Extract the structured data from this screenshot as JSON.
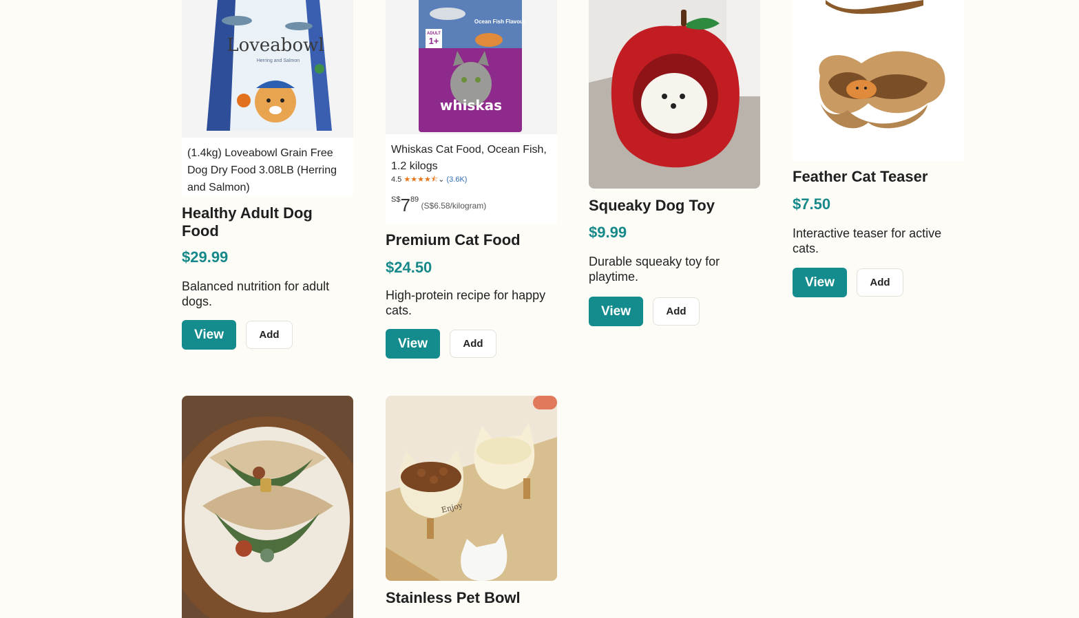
{
  "products": [
    {
      "title": "Healthy Adult Dog Food",
      "price": "$29.99",
      "description": "Balanced nutrition for adult dogs.",
      "view_label": "View",
      "add_label": "Add",
      "image": {
        "bag_brand": "Loveabowl",
        "bag_subtitle": "Herring and Salmon",
        "caption": "(1.4kg) Loveabowl Grain Free Dog Dry Food 3.08LB (Herring and Salmon)"
      }
    },
    {
      "title": "Premium Cat Food",
      "price": "$24.50",
      "description": "High-protein recipe for happy cats.",
      "view_label": "View",
      "add_label": "Add",
      "image": {
        "bag_brand": "whiskas",
        "bag_flavour": "Ocean Fish Flavour",
        "bag_age_line1": "ADULT",
        "bag_age_line2": "1+",
        "caption": "Whiskas Cat Food, Ocean Fish, 1.2 kilogs",
        "rating_value": "4.5",
        "rating_stars": "★★★★⯪",
        "rating_count": "(3.6K)",
        "currency": "S$",
        "price_whole": "7",
        "price_fraction": "89",
        "unit_price": "(S$6.58/kilogram)"
      }
    },
    {
      "title": "Squeaky Dog Toy",
      "price": "$9.99",
      "description": "Durable squeaky toy for playtime.",
      "view_label": "View",
      "add_label": "Add"
    },
    {
      "title": "Feather Cat Teaser",
      "price": "$7.50",
      "description": "Interactive teaser for active cats.",
      "view_label": "View",
      "add_label": "Add"
    },
    {
      "title": "",
      "price": "",
      "description": ""
    },
    {
      "title": "Stainless Pet Bowl",
      "price": "",
      "description": "",
      "image": {
        "bowl_text": "Enjoy"
      }
    }
  ],
  "colors": {
    "accent": "#148b8c",
    "price": "#17898a",
    "background": "#fdfcf7"
  }
}
